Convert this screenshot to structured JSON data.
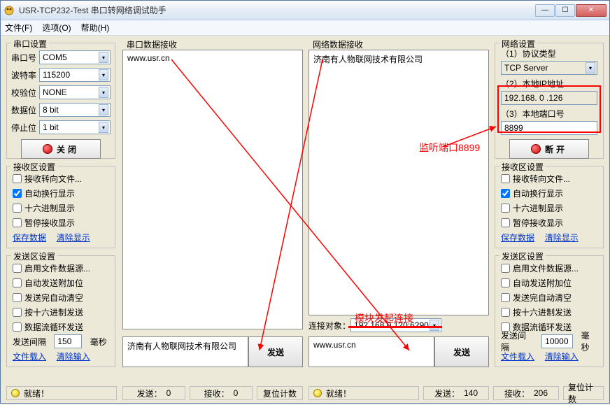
{
  "window": {
    "title": "USR-TCP232-Test 串口转网络调试助手"
  },
  "menu": {
    "file": "文件(F)",
    "options": "选项(O)",
    "help": "帮助(H)"
  },
  "serial_settings": {
    "title": "串口设置",
    "port_label": "串口号",
    "port": "COM5",
    "baud_label": "波特率",
    "baud": "115200",
    "parity_label": "校验位",
    "parity": "NONE",
    "data_label": "数据位",
    "data": "8 bit",
    "stop_label": "停止位",
    "stop": "1 bit",
    "btn": "关闭"
  },
  "recv_settings": {
    "title": "接收区设置",
    "c1": "接收转向文件...",
    "c2": "自动换行显示",
    "c3": "十六进制显示",
    "c4": "暂停接收显示",
    "save": "保存数据",
    "clear": "清除显示"
  },
  "send_settings": {
    "title": "发送区设置",
    "c1": "启用文件数据源...",
    "c2": "自动发送附加位",
    "c3": "发送完自动清空",
    "c4": "按十六进制发送",
    "c5": "数据流循环发送",
    "interval_label": "发送间隔",
    "interval": "150",
    "unit": "毫秒",
    "load": "文件载入",
    "clear": "清除输入"
  },
  "net_settings": {
    "title": "网络设置",
    "proto_label": "（1）协议类型",
    "proto": "TCP Server",
    "ip_label": "（2）本地IP地址",
    "ip": "192.168. 0 .126",
    "port_label": "（3）本地端口号",
    "port": "8899",
    "btn": "断开"
  },
  "net_send_settings": {
    "interval": "10000"
  },
  "serial_recv": {
    "title": "串口数据接收",
    "text": "www.usr.cn"
  },
  "net_recv": {
    "title": "网络数据接收",
    "text": "济南有人物联网技术有限公司"
  },
  "conn_target": {
    "label": "连接对象：",
    "value": "192.168.0.120:6290"
  },
  "serial_send_text": "济南有人物联网技术有限公司",
  "net_send_text": "www.usr.cn",
  "send_btn": "发送",
  "status": {
    "ready": "就绪！",
    "send_label": "发送：",
    "send_l": "0",
    "send_r": "140",
    "recv_label": "接收：",
    "recv_l": "0",
    "recv_r": "206",
    "reset": "复位计数"
  },
  "annotations": {
    "listen": "监听端口8899",
    "module": "模块发起连接"
  }
}
